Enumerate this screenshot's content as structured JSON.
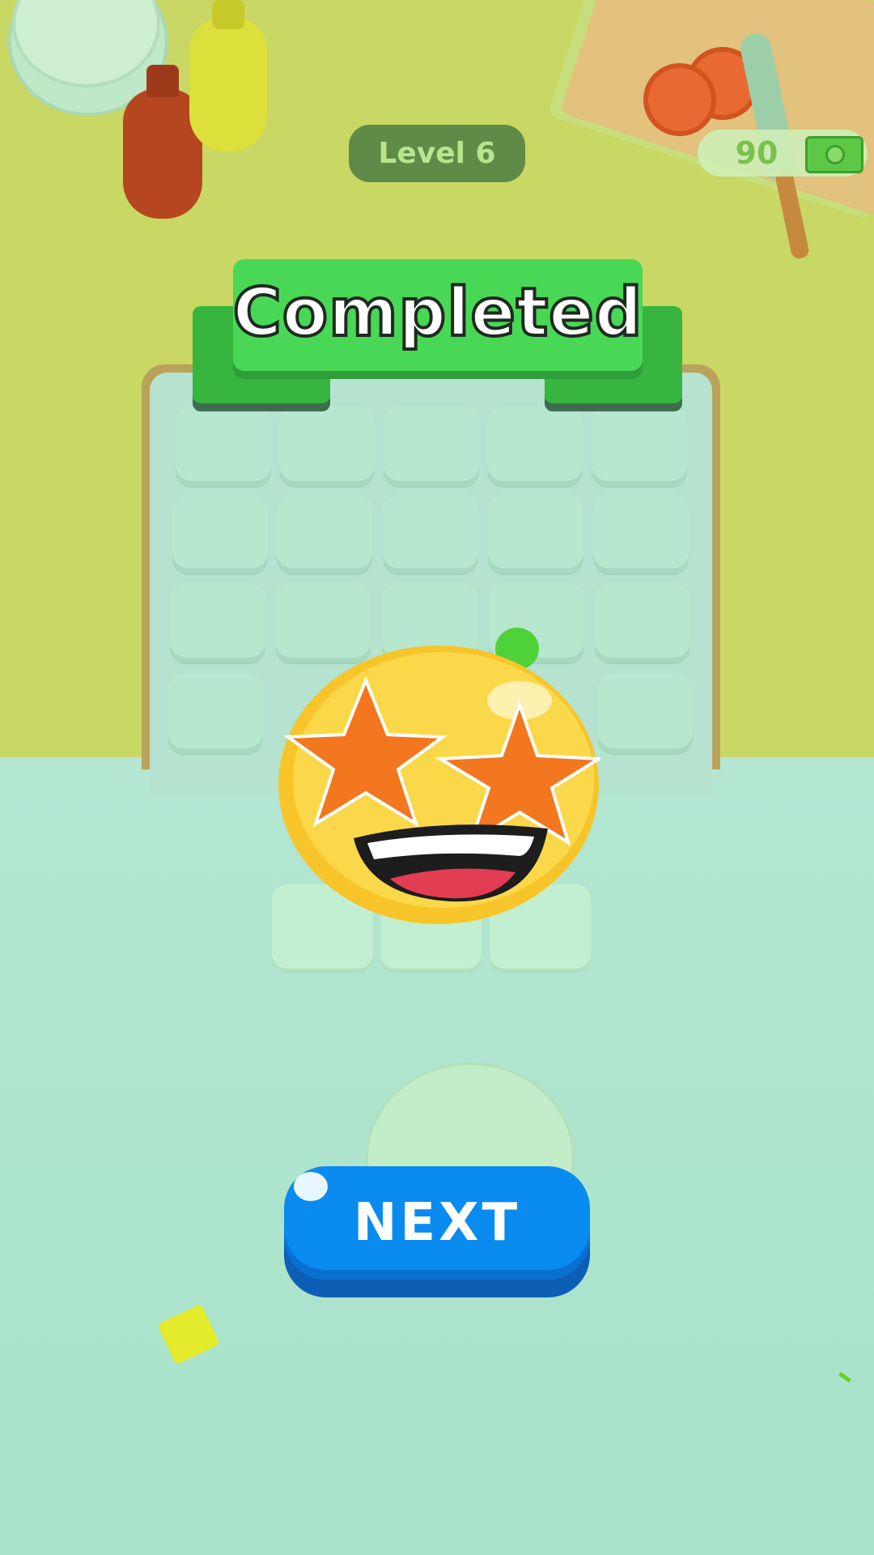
{
  "hud": {
    "level_label": "Level 6",
    "money_value": "90",
    "money_icon": "cash-icon"
  },
  "banner": {
    "title": "Completed"
  },
  "reaction": {
    "emoji": "star-struck-emoji"
  },
  "actions": {
    "next_label": "NEXT"
  },
  "colors": {
    "counter": "#c9d865",
    "floor": "#a9e2cb",
    "banner_green": "#49d855",
    "next_blue": "#0a8bef",
    "level_pill": "#5f8a48"
  }
}
